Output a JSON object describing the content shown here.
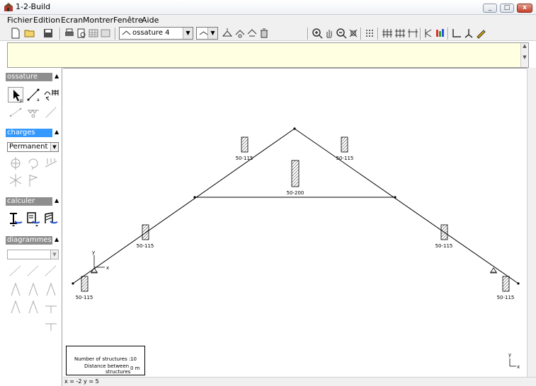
{
  "window": {
    "title": "1-2-Build",
    "minimize": "_",
    "maximize": "□",
    "close": "x"
  },
  "menu": [
    "Fichier",
    "Edition",
    "Ecran",
    "Montrer",
    "Fenêtre",
    "Aide"
  ],
  "toolbar": {
    "structure_select": "ossature 4"
  },
  "panel": {
    "ossature": {
      "label": "ossature",
      "tool_labels": [
        "p",
        "a"
      ]
    },
    "charges": {
      "label": "charges",
      "load_case": "Permanent"
    },
    "calculer": {
      "label": "calculer"
    },
    "diagrammes": {
      "label": "diagrammes",
      "selected": ""
    }
  },
  "drawing": {
    "labels": {
      "top_left": "50-115",
      "top_right": "50-115",
      "center": "50-200",
      "mid_left": "50-115",
      "mid_right": "50-115",
      "bottom_left": "50-115",
      "bottom_right": "50-115"
    },
    "axis": {
      "y": "y",
      "x": "x"
    },
    "info": {
      "number_label": "Number of structures :",
      "number_value": "10",
      "distance_label": "Distance between",
      "distance_label2": "structures",
      "distance_value": "0 m"
    }
  },
  "status": {
    "coords": "x = -2  y = 5"
  }
}
